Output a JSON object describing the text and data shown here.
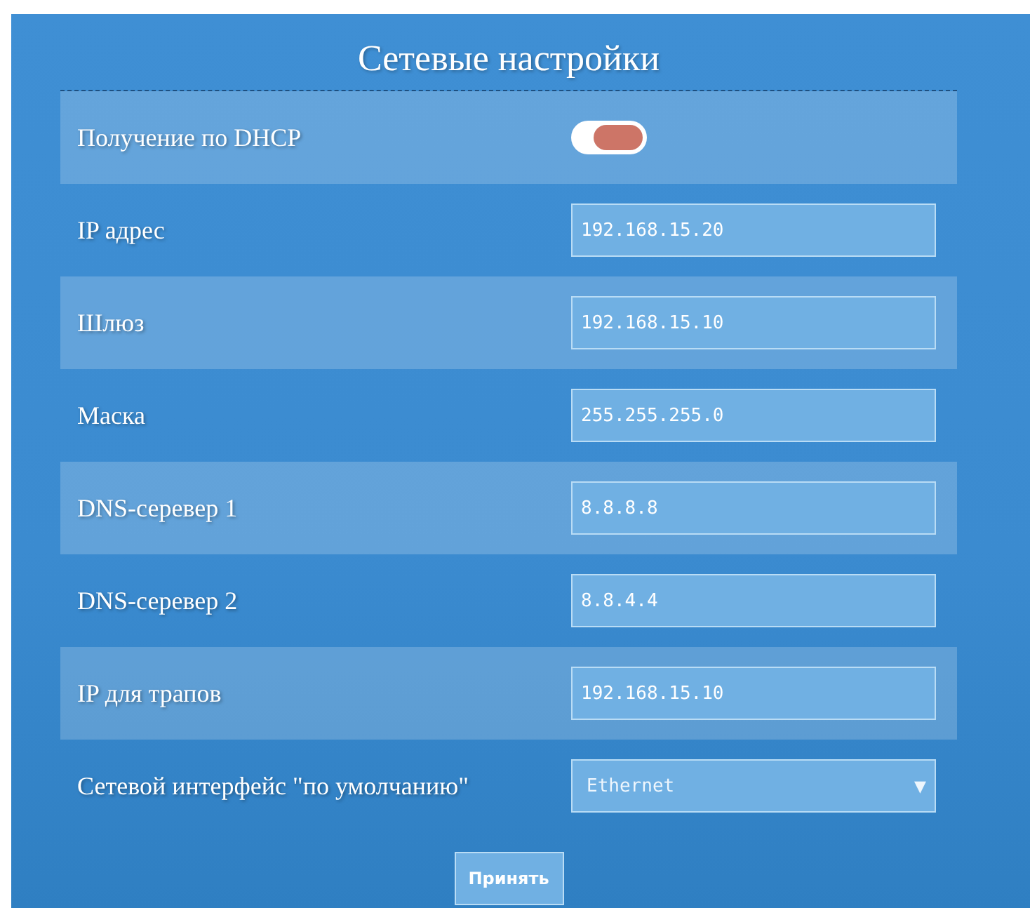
{
  "title": "Сетевые настройки",
  "rows": [
    {
      "kind": "toggle",
      "label": "Получение по DHCP",
      "on": false
    },
    {
      "kind": "input",
      "label": "IP адрес",
      "value": "192.168.15.20"
    },
    {
      "kind": "input",
      "label": "Шлюз",
      "value": "192.168.15.10"
    },
    {
      "kind": "input",
      "label": "Маска",
      "value": "255.255.255.0"
    },
    {
      "kind": "input",
      "label": "DNS-серевер 1",
      "value": "8.8.8.8"
    },
    {
      "kind": "input",
      "label": "DNS-серевер 2",
      "value": "8.8.4.4"
    },
    {
      "kind": "input",
      "label": "IP для трапов",
      "value": "192.168.15.10"
    },
    {
      "kind": "select",
      "label": "Сетевой интерфейс \"по умолчанию\"",
      "value": "Ethernet",
      "arrow": "▼"
    }
  ],
  "button": "Принять"
}
